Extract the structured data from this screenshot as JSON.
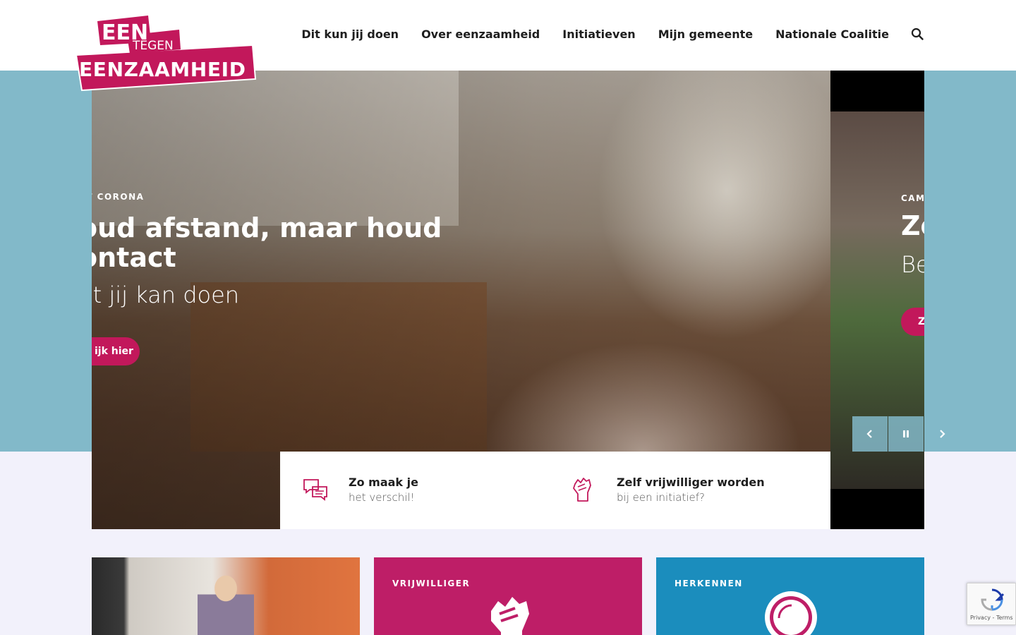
{
  "logo": {
    "line1": "EEN",
    "line2": "TEGEN",
    "line3": "EENZAAMHEID"
  },
  "nav": {
    "items": [
      "Dit kun jij doen",
      "Over eenzaamheid",
      "Initiatieven",
      "Mijn gemeente",
      "Nationale Coalitie"
    ]
  },
  "hero": {
    "slide_main": {
      "kicker": "CT CORONA",
      "title": "oud afstand, maar houd ontact",
      "subtitle": "at jij kan doen",
      "button": "ijk hier"
    },
    "slide_next": {
      "kicker": "CAMI",
      "title": "Zo",
      "subtitle": "Be",
      "button": "Z"
    }
  },
  "quick_links": [
    {
      "title": "Zo maak je",
      "subtitle": "het verschil!",
      "icon": "chat-bubbles-icon"
    },
    {
      "title": "Zelf vrijwilliger worden",
      "subtitle": "bij een initiatief?",
      "icon": "raised-fist-icon"
    }
  ],
  "cards": [
    {
      "label": "",
      "type": "photo"
    },
    {
      "label": "VRIJWILLIGER",
      "icon": "raised-fist-icon"
    },
    {
      "label": "HERKENNEN",
      "icon": "circle-icon"
    }
  ],
  "recaptcha": {
    "links": "Privacy - Terms"
  },
  "colors": {
    "brand": "#c2185b",
    "hero_band": "#82b9c9",
    "card_blue": "#1b8dbd",
    "page_bg": "#f2f1fb"
  }
}
